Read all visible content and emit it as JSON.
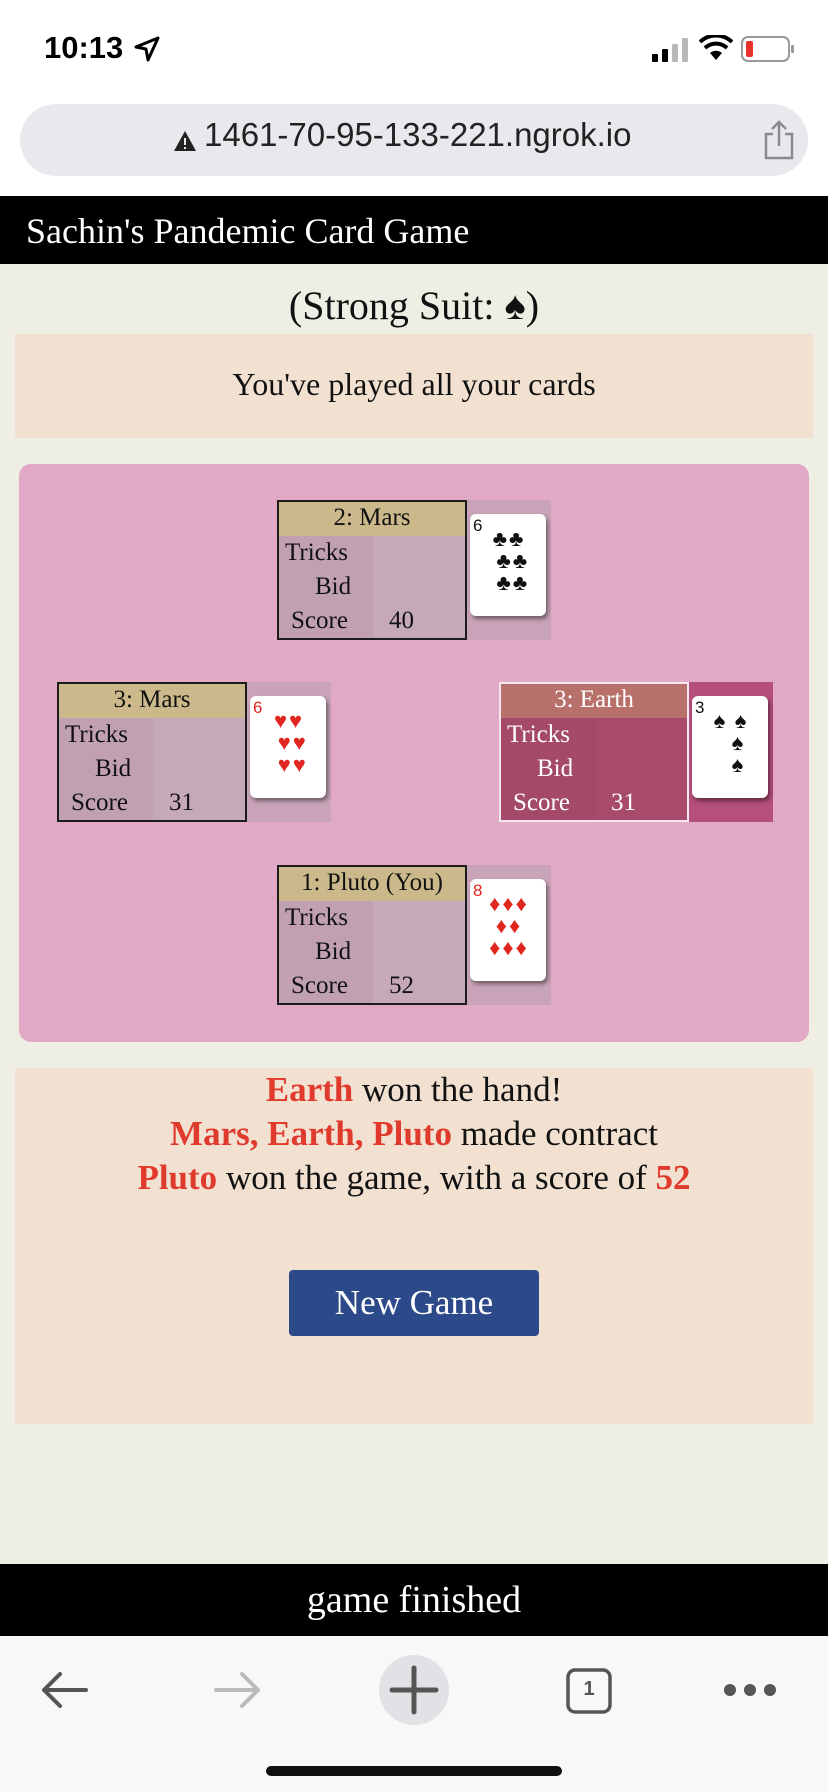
{
  "status_bar": {
    "time": "10:13"
  },
  "browser": {
    "url": "1461-70-95-133-221.ngrok.io",
    "tab_count": "1"
  },
  "app": {
    "title": "Sachin's Pandemic Card Game",
    "strong_suit_prefix": "(Strong Suit: ",
    "strong_suit_symbol": "♠",
    "strong_suit_suffix": ")",
    "message": "You've played all your cards"
  },
  "labels": {
    "tricks": "Tricks",
    "bid": "Bid",
    "score": "Score"
  },
  "players": {
    "north": {
      "name": "2: Mars",
      "tricks": "",
      "bid": "",
      "score": "40",
      "card_rank": "6",
      "card_suit": "♣",
      "card_color": "black",
      "active": false
    },
    "west": {
      "name": "3: Mars",
      "tricks": "",
      "bid": "",
      "score": "31",
      "card_rank": "6",
      "card_suit": "♥",
      "card_color": "red",
      "active": false
    },
    "east": {
      "name": "3: Earth",
      "tricks": "",
      "bid": "",
      "score": "31",
      "card_rank": "3",
      "card_suit": "♠",
      "card_color": "black",
      "active": true
    },
    "south": {
      "name": "1: Pluto (You)",
      "tricks": "",
      "bid": "",
      "score": "52",
      "card_rank": "8",
      "card_suit": "♦",
      "card_color": "red",
      "active": false
    }
  },
  "result": {
    "line1_highlight": "Earth",
    "line1_text": " won the hand!",
    "line2_highlight": "Mars, Earth, Pluto",
    "line2_text": " made contract",
    "line3_highlight": "Pluto",
    "line3_text": " won the game, with a score of ",
    "line3_score": "52",
    "new_game_label": "New Game"
  },
  "footer": {
    "status": "game finished"
  },
  "colors": {
    "table": "#e2a9c6",
    "panel": "#f2e1d1",
    "highlight": "#e03a2c",
    "button": "#2c4a8a",
    "active_player": "#a84a6c"
  }
}
